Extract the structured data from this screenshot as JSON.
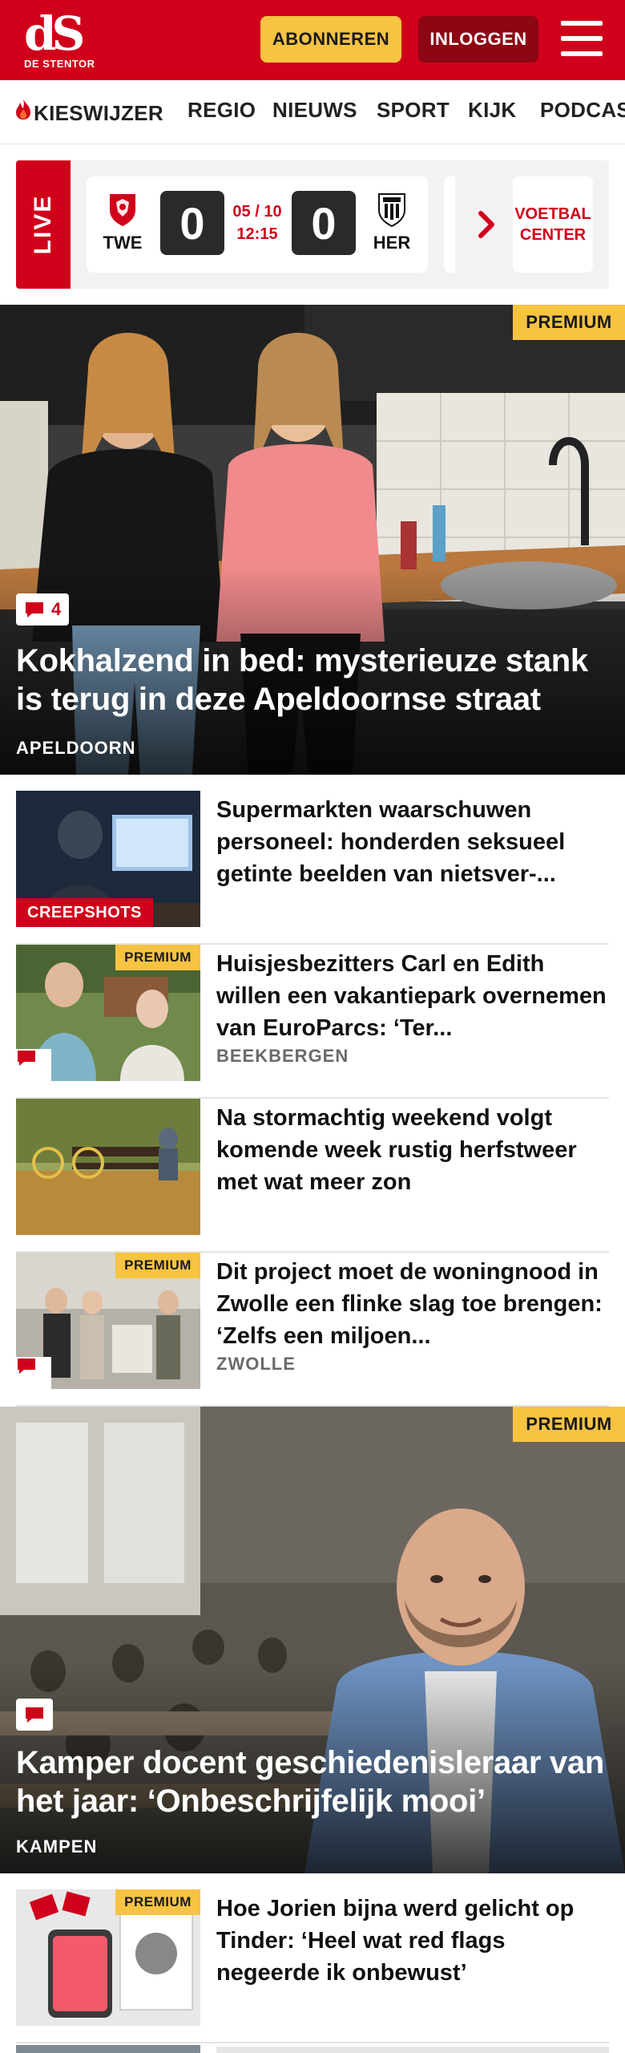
{
  "header": {
    "logo_mark": "dS",
    "logo_sub": "DE STENTOR",
    "subscribe_label": "ABONNEREN",
    "login_label": "INLOGGEN",
    "menu_icon": "hamburger-menu-icon",
    "brand_color": "#d0021b",
    "accent_color": "#f6c343"
  },
  "nav": {
    "items": [
      "KIESWIJZER",
      "REGIO",
      "NIEUWS",
      "SPORT",
      "KIJK",
      "PODCAS"
    ],
    "flame_icon": "flame-icon"
  },
  "live": {
    "label": "LIVE",
    "match": {
      "home_code": "TWE",
      "home_score": "0",
      "away_code": "HER",
      "away_score": "0",
      "date": "05 / 10",
      "time": "12:15"
    },
    "voetbal_center_label": "VOETBAL CENTER"
  },
  "hero1": {
    "premium_label": "PREMIUM",
    "comments": "4",
    "title": "Kokhalzend in bed: mysterieuze stank is terug in deze Apeldoornse straat",
    "location": "APELDOORN"
  },
  "list1": [
    {
      "title": "Supermarkten waarschuwen personeel: honderden seksueel getinte beelden van nietsver-...",
      "tag": "CREEPSHOTS",
      "premium": "",
      "location": ""
    },
    {
      "title": "Huisjesbezitters Carl en Edith willen een vakantiepark overnemen van EuroParcs: ‘Ter...",
      "tag": "",
      "premium": "PREMIUM",
      "location": "BEEKBERGEN"
    },
    {
      "title": "Na stormachtig weekend volgt komende week rustig herfstweer met wat meer zon",
      "tag": "",
      "premium": "",
      "location": ""
    },
    {
      "title": "Dit project moet de woningnood in Zwolle een flinke slag toe brengen: ‘Zelfs een miljoen...",
      "tag": "",
      "premium": "PREMIUM",
      "location": "ZWOLLE"
    }
  ],
  "hero2": {
    "premium_label": "PREMIUM",
    "title": "Kamper docent geschiedenisleraar van het jaar: ‘Onbeschrijfelijk mooi’",
    "location": "KAMPEN"
  },
  "list2": [
    {
      "title": "Hoe Jorien bijna werd gelicht op Tinder: ‘Heel wat red flags negeerde ik onbewust’",
      "premium": "PREMIUM"
    }
  ]
}
